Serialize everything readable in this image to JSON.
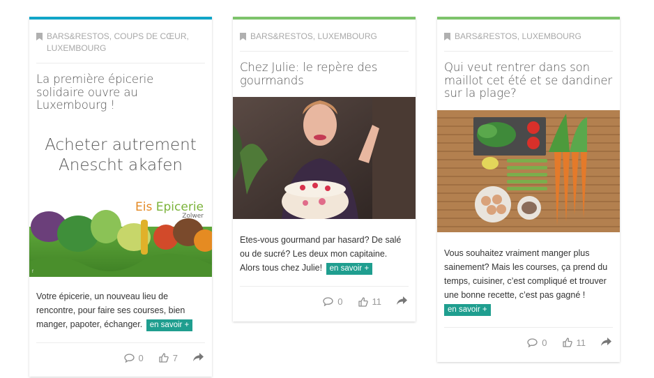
{
  "cards": [
    {
      "accent": "#11a5c8",
      "categories": "BARS&RESTOS, COUPS DE CŒUR, LUXEMBOURG",
      "title": "La première épicerie solidaire ouvre au Luxembourg !",
      "image_text": {
        "line1": "Acheter autrement",
        "line2": "Anescht akafen",
        "brand_a": "Eis ",
        "brand_b": "Epicerie",
        "brand_sub": "Zolwer"
      },
      "excerpt": "Votre épicerie, un nouveau lieu de rencontre, pour faire ses courses, bien manger, papoter, échanger.",
      "more": "en savoir +",
      "comments": "0",
      "likes": "7",
      "icons": [
        "bookmark-icon",
        "comment-icon",
        "thumbs-up-icon",
        "share-icon"
      ]
    },
    {
      "accent": "#7dc36b",
      "categories": "BARS&RESTOS, LUXEMBOURG",
      "title": "Chez Julie: le repère des gourmands",
      "excerpt": "Etes-vous gourmand par hasard? De salé ou de sucré? Les deux mon capitaine. Alors tous chez Julie!",
      "more": "en savoir +",
      "comments": "0",
      "likes": "11"
    },
    {
      "accent": "#7dc36b",
      "categories": "BARS&RESTOS, LUXEMBOURG",
      "title": "Qui veut rentrer dans son maillot cet été et se dandiner sur la plage?",
      "excerpt": "Vous souhaitez vraiment manger plus sainement? Mais les courses, ça prend du temps, cuisiner, c’est compliqué et trouver une bonne recette, c’est pas gagné !",
      "more": "en savoir +",
      "comments": "0",
      "likes": "11"
    }
  ]
}
